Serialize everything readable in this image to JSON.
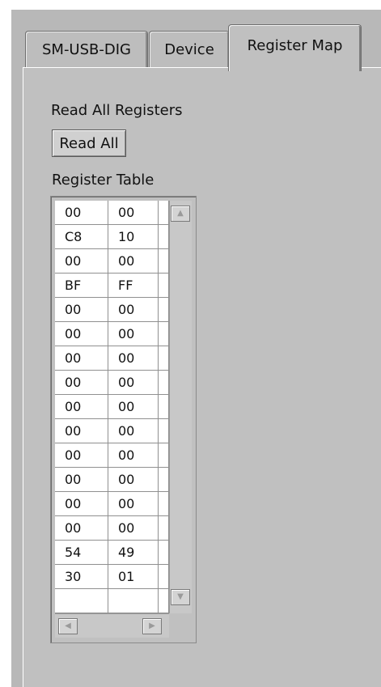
{
  "tabs": [
    {
      "label": "SM-USB-DIG"
    },
    {
      "label": "Device"
    },
    {
      "label": "Register Map"
    }
  ],
  "register_map": {
    "read_all_label": "Read All Registers",
    "read_all_button": "Read All",
    "table_label": "Register Table",
    "rows": [
      [
        "00",
        "00"
      ],
      [
        "C8",
        "10"
      ],
      [
        "00",
        "00"
      ],
      [
        "BF",
        "FF"
      ],
      [
        "00",
        "00"
      ],
      [
        "00",
        "00"
      ],
      [
        "00",
        "00"
      ],
      [
        "00",
        "00"
      ],
      [
        "00",
        "00"
      ],
      [
        "00",
        "00"
      ],
      [
        "00",
        "00"
      ],
      [
        "00",
        "00"
      ],
      [
        "00",
        "00"
      ],
      [
        "00",
        "00"
      ],
      [
        "54",
        "49"
      ],
      [
        "30",
        "01"
      ],
      [
        "",
        ""
      ]
    ]
  },
  "icons": {
    "scroll_up": "up-arrow-icon",
    "scroll_down": "down-arrow-icon",
    "scroll_left": "left-arrow-icon",
    "scroll_right": "right-arrow-icon"
  }
}
